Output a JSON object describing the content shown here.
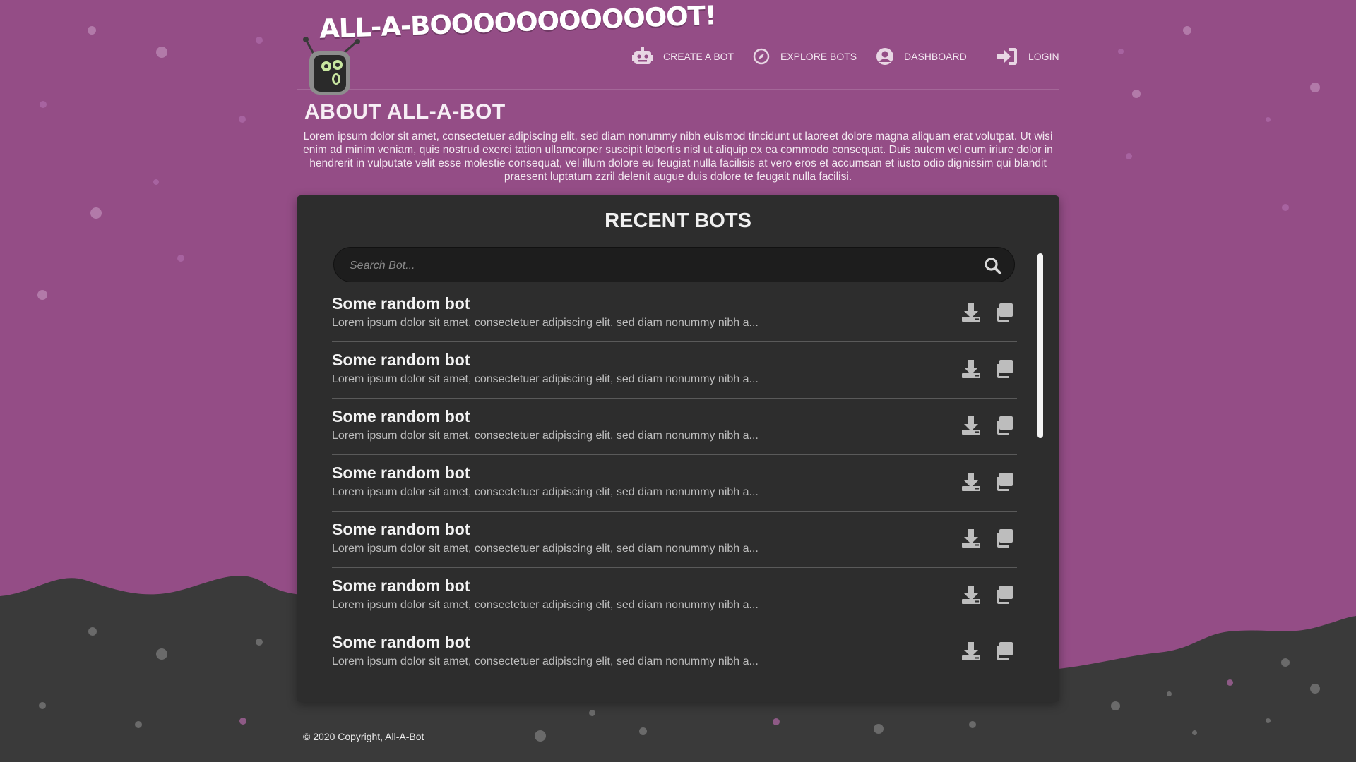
{
  "brand": {
    "logo_text": "ALL-A-BOOOOOOOOOOOOT!"
  },
  "nav": [
    {
      "label": "CREATE A BOT",
      "icon": "robot-icon"
    },
    {
      "label": "EXPLORE BOTS",
      "icon": "compass-icon"
    },
    {
      "label": "DASHBOARD",
      "icon": "user-circle-icon"
    },
    {
      "label": "LOGIN",
      "icon": "sign-in-icon"
    }
  ],
  "about": {
    "title": "ABOUT ALL-A-BOT",
    "text": "Lorem ipsum dolor sit amet, consectetuer adipiscing elit, sed diam nonummy nibh euismod tincidunt ut laoreet dolore magna aliquam erat volutpat. Ut wisi enim ad minim veniam, quis nostrud exerci tation ullamcorper suscipit lobortis nisl ut aliquip ex ea commodo consequat. Duis autem vel eum iriure dolor in hendrerit in vulputate velit esse molestie consequat, vel illum dolore eu feugiat nulla facilisis at vero eros et accumsan et iusto odio dignissim qui blandit praesent luptatum zzril delenit augue duis dolore te feugait nulla facilisi."
  },
  "recent": {
    "title": "RECENT BOTS",
    "search_placeholder": "Search Bot...",
    "search_value": "",
    "bots": [
      {
        "name": "Some random bot",
        "description": "Lorem ipsum dolor sit amet, consectetuer adipiscing elit, sed diam nonummy nibh a..."
      },
      {
        "name": "Some random bot",
        "description": "Lorem ipsum dolor sit amet, consectetuer adipiscing elit, sed diam nonummy nibh a..."
      },
      {
        "name": "Some random bot",
        "description": "Lorem ipsum dolor sit amet, consectetuer adipiscing elit, sed diam nonummy nibh a..."
      },
      {
        "name": "Some random bot",
        "description": "Lorem ipsum dolor sit amet, consectetuer adipiscing elit, sed diam nonummy nibh a..."
      },
      {
        "name": "Some random bot",
        "description": "Lorem ipsum dolor sit amet, consectetuer adipiscing elit, sed diam nonummy nibh a..."
      },
      {
        "name": "Some random bot",
        "description": "Lorem ipsum dolor sit amet, consectetuer adipiscing elit, sed diam nonummy nibh a..."
      },
      {
        "name": "Some random bot",
        "description": "Lorem ipsum dolor sit amet, consectetuer adipiscing elit, sed diam nonummy nibh a..."
      }
    ],
    "actions": {
      "download_icon": "download-icon",
      "copy_icon": "copy-icon"
    }
  },
  "footer": {
    "copyright": "© 2020 Copyright, All-A-Bot"
  },
  "colors": {
    "background_top": "#944d86",
    "background_bottom": "#3a3a3a",
    "panel": "#2d2d2d",
    "accent_dot": "#b075a6"
  }
}
